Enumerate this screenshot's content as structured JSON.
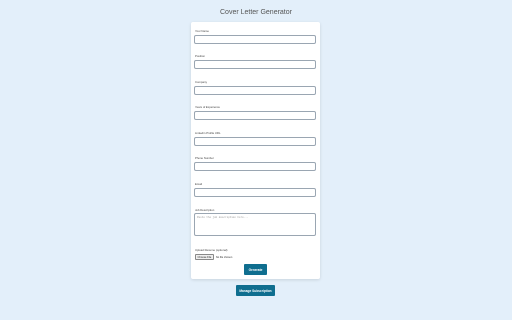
{
  "page": {
    "title": "Cover Letter Generator"
  },
  "form": {
    "fields": [
      {
        "label": "Your Name",
        "value": ""
      },
      {
        "label": "Position",
        "value": ""
      },
      {
        "label": "Company",
        "value": ""
      },
      {
        "label": "Years of Experience",
        "value": ""
      },
      {
        "label": "Linkedin Profile URL",
        "value": ""
      },
      {
        "label": "Phone Number",
        "value": ""
      },
      {
        "label": "Email",
        "value": ""
      }
    ],
    "job_description": {
      "label": "Job Description",
      "placeholder": "Paste the job description here..."
    },
    "resume": {
      "label": "Upload Resume (optional)",
      "button_label": "Choose File",
      "status": "No file chosen"
    },
    "generate_label": "Generate"
  },
  "footer": {
    "manage_subscription_label": "Manage Subscription"
  },
  "colors": {
    "background": "#e3effa",
    "card": "#ffffff",
    "accent": "#0f6e8f"
  }
}
